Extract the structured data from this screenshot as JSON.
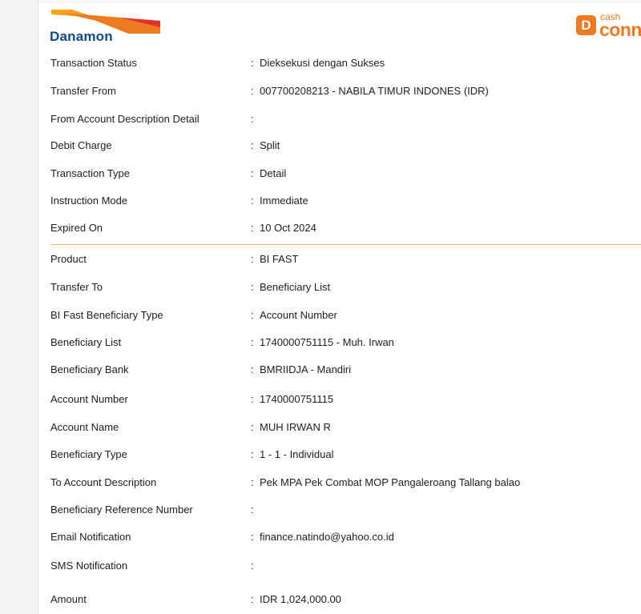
{
  "header": {
    "bank_logo_text": "Danamon",
    "cash_logo_letter": "D",
    "cash_logo_small": "cash",
    "cash_logo_large": "conn",
    "brand_color": "#f07a22",
    "logo_blue": "#0f4a8f"
  },
  "section_main": [
    {
      "label": "Transaction Status",
      "value": "Dieksekusi dengan Sukses"
    },
    {
      "label": "Transfer From",
      "value": "007700208213 - NABILA TIMUR INDONES (IDR)"
    },
    {
      "label": "From Account Description Detail",
      "value": ""
    },
    {
      "label": "Debit Charge",
      "value": "Split"
    },
    {
      "label": "Transaction Type",
      "value": "Detail"
    },
    {
      "label": "Instruction Mode",
      "value": "Immediate"
    },
    {
      "label": "Expired On",
      "value": "10 Oct 2024"
    }
  ],
  "section_detail": [
    {
      "label": "Product",
      "value": "BI FAST"
    },
    {
      "label": "Transfer To",
      "value": "Beneficiary List"
    },
    {
      "label": "BI Fast Beneficiary Type",
      "value": "Account Number"
    },
    {
      "label": "Beneficiary List",
      "value": "1740000751115 - Muh. Irwan"
    },
    {
      "label": "Beneficiary Bank",
      "value": "BMRIIDJA - Mandiri"
    },
    {
      "label": "Account Number",
      "value": "1740000751115"
    },
    {
      "label": "Account Name",
      "value": "MUH IRWAN R"
    },
    {
      "label": "Beneficiary Type",
      "value": "1 - 1 - Individual"
    },
    {
      "label": "To Account Description",
      "value": "Pek MPA Pek Combat MOP Pangaleroang Tallang balao"
    },
    {
      "label": "Beneficiary Reference Number",
      "value": ""
    },
    {
      "label": "Email Notification",
      "value": "finance.natindo@yahoo.co.id"
    },
    {
      "label": "SMS Notification",
      "value": ""
    },
    {
      "label": "Amount",
      "value": "IDR 1,024,000.00"
    }
  ],
  "separator": ":"
}
